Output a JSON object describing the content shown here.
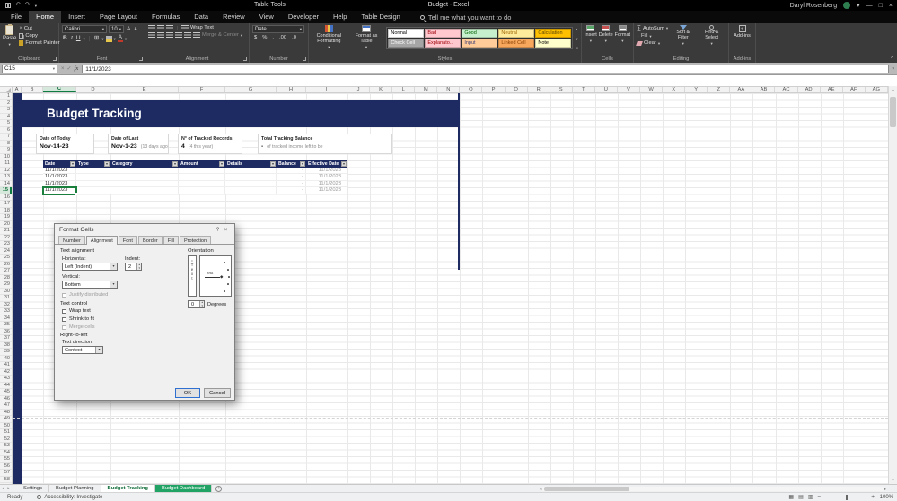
{
  "colors": {
    "accent_navy": "#1E2B63",
    "accent_green": "#107C41"
  },
  "titlebar": {
    "context_group": "Table Tools",
    "document_title": "Budget - Excel",
    "user_name": "Daryl Rosenberg"
  },
  "search_label": "Tell me what you want to do",
  "ribbon_tabs": [
    {
      "label": "File",
      "active": false
    },
    {
      "label": "Home",
      "active": true
    },
    {
      "label": "Insert",
      "active": false
    },
    {
      "label": "Page Layout",
      "active": false
    },
    {
      "label": "Formulas",
      "active": false
    },
    {
      "label": "Data",
      "active": false
    },
    {
      "label": "Review",
      "active": false
    },
    {
      "label": "View",
      "active": false
    },
    {
      "label": "Developer",
      "active": false
    },
    {
      "label": "Help",
      "active": false
    },
    {
      "label": "Table Design",
      "active": false
    }
  ],
  "ribbon": {
    "clipboard": {
      "group_label": "Clipboard",
      "paste": "Paste",
      "cut": "Cut",
      "copy": "Copy",
      "format_painter": "Format Painter"
    },
    "font": {
      "group_label": "Font",
      "family": "Calibri",
      "size": "10",
      "bold": "B",
      "italic": "I",
      "underline": "U",
      "grow": "A",
      "shrink": "A",
      "color_letter": "A"
    },
    "alignment": {
      "group_label": "Alignment",
      "wrap_text": "Wrap Text",
      "merge_center": "Merge & Center"
    },
    "number": {
      "group_label": "Number",
      "format": "Date",
      "buttons": [
        "$",
        "%",
        ",",
        ".00",
        ".0"
      ]
    },
    "styles": {
      "group_label": "Styles",
      "conditional": "Conditional Formatting",
      "format_table": "Format as Table",
      "gallery": [
        {
          "name": "Normal",
          "bg": "#FFFFFF",
          "fg": "#000000"
        },
        {
          "name": "Bad",
          "bg": "#FFC7CE",
          "fg": "#9C0006"
        },
        {
          "name": "Good",
          "bg": "#C6EFCE",
          "fg": "#006100"
        },
        {
          "name": "Neutral",
          "bg": "#FFEB9C",
          "fg": "#9C6500"
        },
        {
          "name": "Calculation",
          "bg": "#FFC000",
          "fg": "#5A4500"
        },
        {
          "name": "Check Cell",
          "bg": "#A5A5A5",
          "fg": "#FFFFFF"
        },
        {
          "name": "Explanato...",
          "bg": "#FFC7CE",
          "fg": "#9C0006"
        },
        {
          "name": "Input",
          "bg": "#FFCC99",
          "fg": "#3F3F76"
        },
        {
          "name": "Linked Cell",
          "bg": "#F8A85D",
          "fg": "#833C00"
        },
        {
          "name": "Note",
          "bg": "#FFFFCC",
          "fg": "#000000"
        }
      ]
    },
    "cells": {
      "group_label": "Cells",
      "insert": "Insert",
      "delete": "Delete",
      "format": "Format"
    },
    "editing": {
      "group_label": "Editing",
      "autosum": "AutoSum",
      "fill": "Fill",
      "clear": "Clear",
      "sort_filter": "Sort & Filter",
      "find_select": "Find & Select"
    },
    "addins": {
      "group_label": "Add-ins",
      "button": "Add-ins"
    }
  },
  "formula_bar": {
    "name_box": "C15",
    "fx": "fx",
    "content": "11/1/2023"
  },
  "sheet": {
    "columns": [
      "A",
      "B",
      "C",
      "D",
      "E",
      "F",
      "G",
      "H",
      "I",
      "J",
      "K",
      "L",
      "M",
      "N",
      "O",
      "P",
      "Q",
      "R",
      "S",
      "T",
      "U",
      "V",
      "W",
      "X",
      "Y",
      "Z",
      "AA",
      "AB",
      "AC",
      "AD",
      "AE",
      "AF",
      "AG"
    ],
    "selected_column": "C",
    "row_count": 58,
    "selected_row": 15,
    "title": "Budget Tracking",
    "cards": [
      {
        "label": "Date of Today",
        "value": "Nov-14-23",
        "sub": ""
      },
      {
        "label": "Date of Last",
        "value": "Nov-1-23",
        "sub": "(13 days ago)"
      },
      {
        "label": "N° of Tracked Records",
        "value": "4",
        "sub": "(4 this year)"
      },
      {
        "label": "Total Tracking Balance",
        "value": "-",
        "sub": "of tracked income left to be"
      }
    ],
    "table": {
      "headers": [
        "Date",
        "Type",
        "Category",
        "Amount",
        "Details",
        "Balance",
        "Effective Date"
      ],
      "rows": [
        {
          "date": "11/1/2023",
          "type": "",
          "category": "",
          "amount": "",
          "details": "",
          "balance": "-",
          "effective_date": "11/1/2023"
        },
        {
          "date": "11/1/2023",
          "type": "",
          "category": "",
          "amount": "",
          "details": "",
          "balance": "-",
          "effective_date": "11/1/2023"
        },
        {
          "date": "11/1/2023",
          "type": "",
          "category": "",
          "amount": "",
          "details": "",
          "balance": "-",
          "effective_date": "11/1/2023"
        },
        {
          "date": "11/1/2023",
          "type": "",
          "category": "",
          "amount": "",
          "details": "",
          "balance": "-",
          "effective_date": "11/1/2023"
        }
      ]
    }
  },
  "dialog": {
    "title": "Format Cells",
    "help": "?",
    "close": "×",
    "tabs": [
      {
        "label": "Number",
        "active": false
      },
      {
        "label": "Alignment",
        "active": true
      },
      {
        "label": "Font",
        "active": false
      },
      {
        "label": "Border",
        "active": false
      },
      {
        "label": "Fill",
        "active": false
      },
      {
        "label": "Protection",
        "active": false
      }
    ],
    "text_alignment_section": "Text alignment",
    "horizontal_label": "Horizontal:",
    "horizontal_value": "Left (Indent)",
    "indent_label": "Indent:",
    "indent_value": "2",
    "vertical_label": "Vertical:",
    "vertical_value": "Bottom",
    "justify_distributed": "Justify distributed",
    "text_control_section": "Text control",
    "checkboxes": [
      {
        "label": "Wrap text",
        "checked": false,
        "disabled": false
      },
      {
        "label": "Shrink to fit",
        "checked": false,
        "disabled": false
      },
      {
        "label": "Merge cells",
        "checked": false,
        "disabled": true
      }
    ],
    "rtl_section": "Right-to-left",
    "text_direction_label": "Text direction:",
    "text_direction_value": "Context",
    "orientation_section": "Orientation",
    "orientation_text": "Text",
    "degrees_value": "0",
    "degrees_label": "Degrees",
    "ok": "OK",
    "cancel": "Cancel"
  },
  "sheet_tabs": [
    {
      "label": "Settings",
      "state": "normal"
    },
    {
      "label": "Budget Planning",
      "state": "normal"
    },
    {
      "label": "Budget Tracking",
      "state": "active"
    },
    {
      "label": "Budget Dashboard",
      "state": "colored"
    }
  ],
  "status_bar": {
    "mode": "Ready",
    "accessibility": "Accessibility: Investigate",
    "zoom": "100%"
  }
}
